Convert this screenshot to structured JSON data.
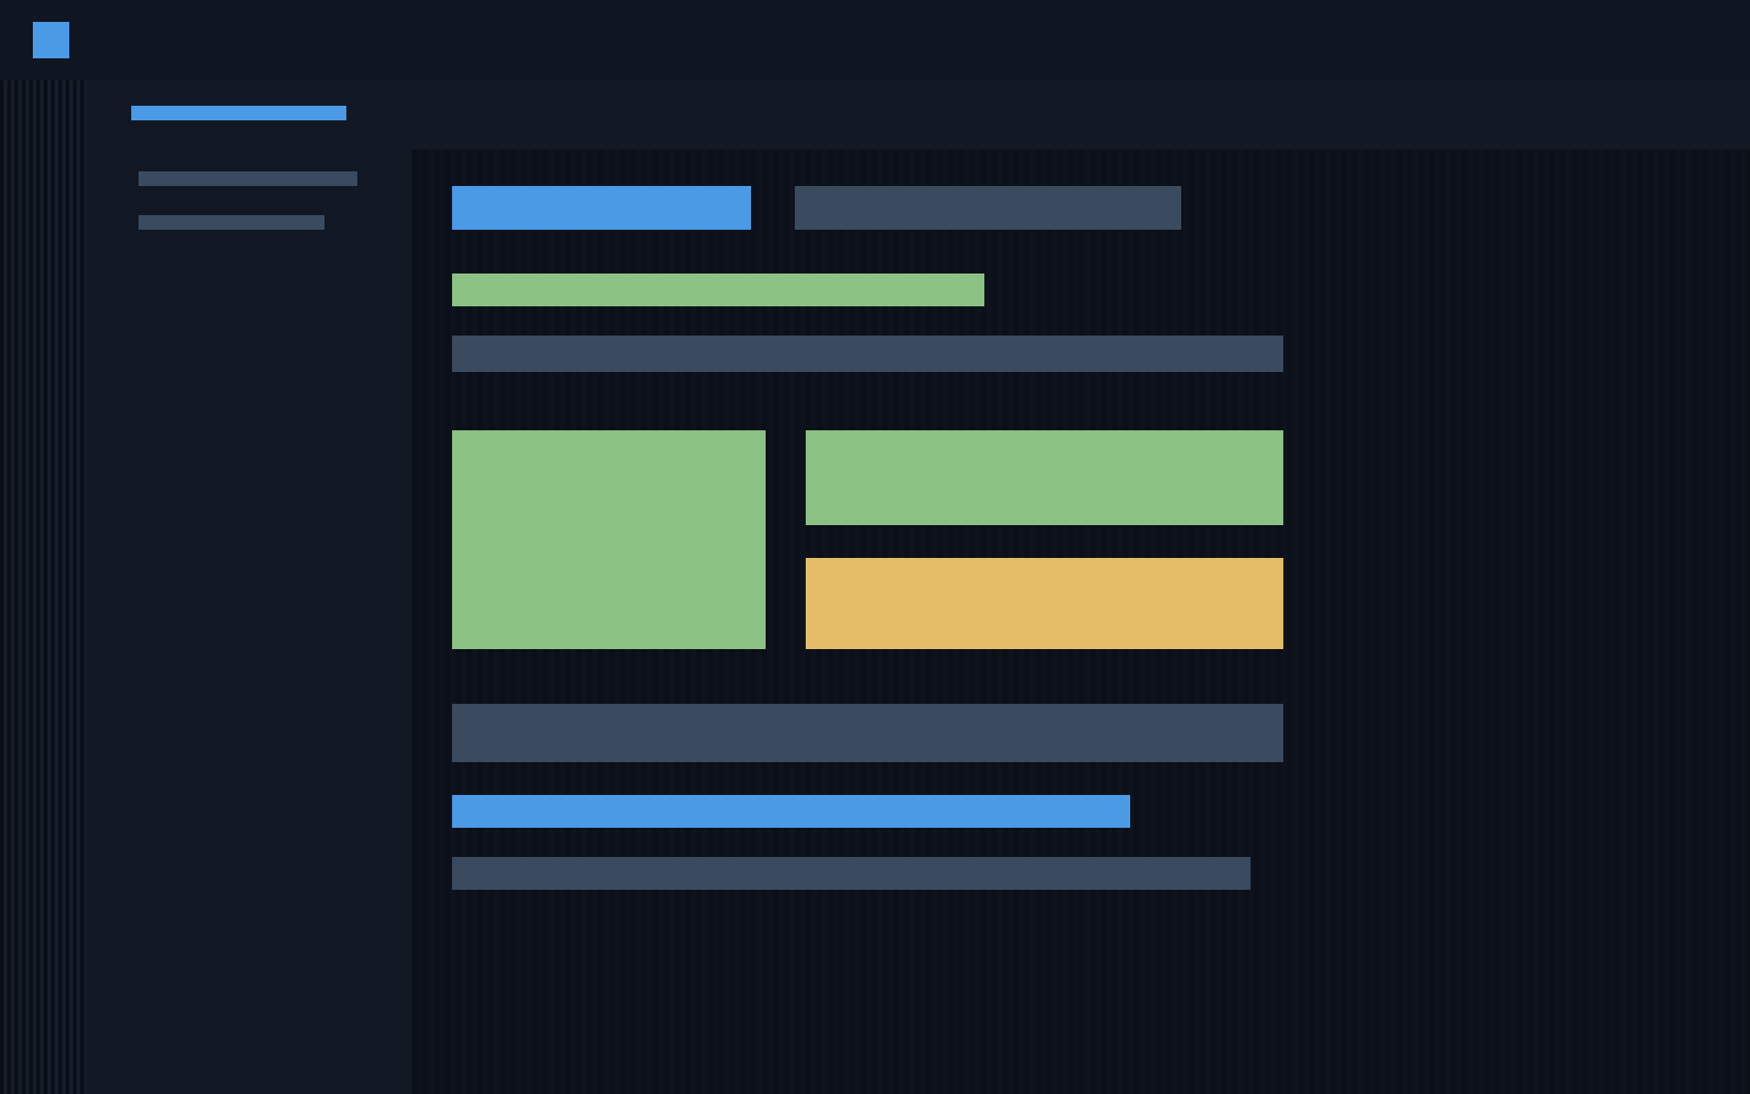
{
  "logo": {
    "color": "#4a9ae6"
  },
  "sidebar": {
    "items": [
      {
        "selected": true
      },
      {
        "selected": false
      },
      {
        "selected": false
      }
    ]
  },
  "content": {
    "blocks": [
      {
        "color": "#4a9ae6"
      },
      {
        "color": "#3a4a5f"
      },
      {
        "color": "#8bc283"
      },
      {
        "color": "#3a4a5f"
      },
      {
        "color": "#8bc283"
      },
      {
        "color": "#8bc283"
      },
      {
        "color": "#e5bd68"
      },
      {
        "color": "#3a4a5f"
      },
      {
        "color": "#4a9ae6"
      },
      {
        "color": "#3a4a5f"
      }
    ]
  }
}
